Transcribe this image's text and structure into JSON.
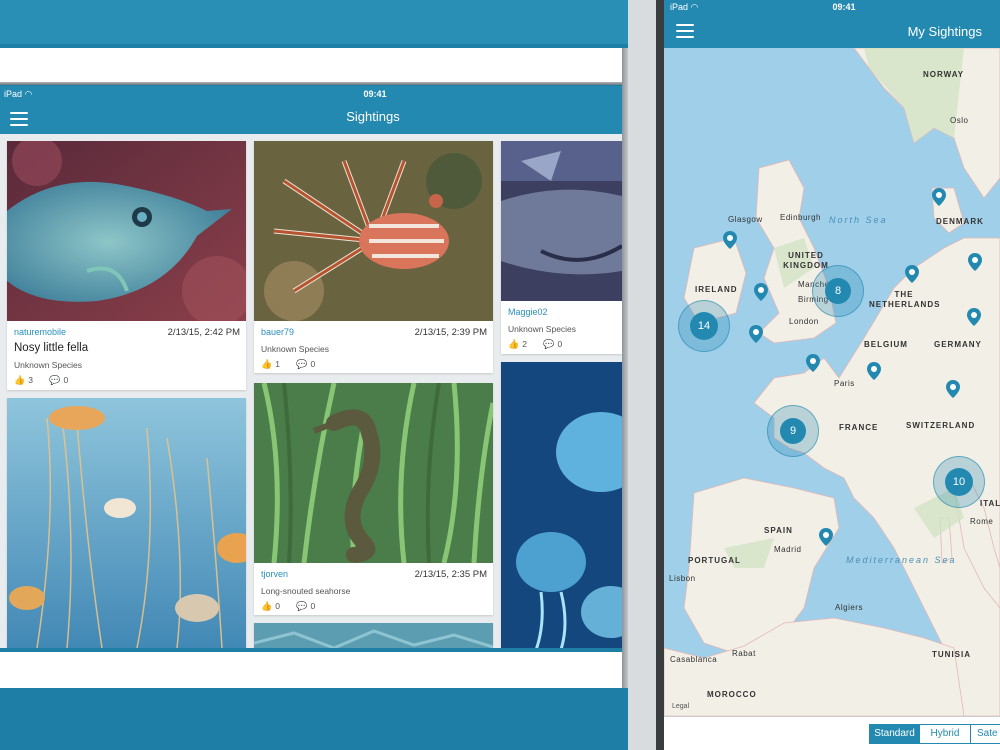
{
  "left_app": {
    "status": {
      "carrier": "iPad",
      "time": "09:41"
    },
    "nav_title": "Sightings",
    "cards": [
      {
        "user": "naturemobile",
        "timestamp": "2/13/15, 2:42 PM",
        "caption": "Nosy little fella",
        "species": "Unknown Species",
        "likes": "3",
        "comments": "0"
      },
      {
        "user": "bauer79",
        "timestamp": "2/13/15, 2:39 PM",
        "species": "Unknown Species",
        "likes": "1",
        "comments": "0"
      },
      {
        "user": "Maggie02",
        "species": "Unknown Species",
        "likes": "2",
        "comments": "0"
      },
      {
        "user": "tjorven",
        "timestamp": "2/13/15, 2:35 PM",
        "species": "Long-snouted seahorse",
        "likes": "0",
        "comments": "0"
      }
    ]
  },
  "right_app": {
    "status": {
      "carrier": "iPad"
    },
    "nav_title": "My Sightings",
    "map": {
      "countries": [
        "NORWAY",
        "DENMARK",
        "UNITED KINGDOM",
        "IRELAND",
        "THE NETHERLANDS",
        "BELGIUM",
        "GERMANY",
        "FRANCE",
        "SWITZERLAND",
        "SPAIN",
        "PORTUGAL",
        "ITAL",
        "MOROCCO",
        "TUNISIA"
      ],
      "cities": [
        "Oslo",
        "Glasgow",
        "Edinburgh",
        "Manchester",
        "Birming",
        "London",
        "Paris",
        "Madrid",
        "Lisbon",
        "Rome",
        "Algiers",
        "Rabat",
        "Casablanca"
      ],
      "seas": [
        "North Sea",
        "Mediterranean Sea"
      ],
      "legal": "Legal",
      "clusters": [
        "14",
        "8",
        "9",
        "10"
      ]
    },
    "map_types": [
      "Standard",
      "Hybrid",
      "Sate"
    ],
    "selected_map_type": "Standard"
  },
  "colors": {
    "brand": "#2489b0",
    "link": "#2a8fc0"
  },
  "icons": {
    "menu": "hamburger-icon",
    "like": "thumbs-up-icon",
    "comment": "speech-bubble-icon",
    "pin": "map-pin-icon"
  }
}
